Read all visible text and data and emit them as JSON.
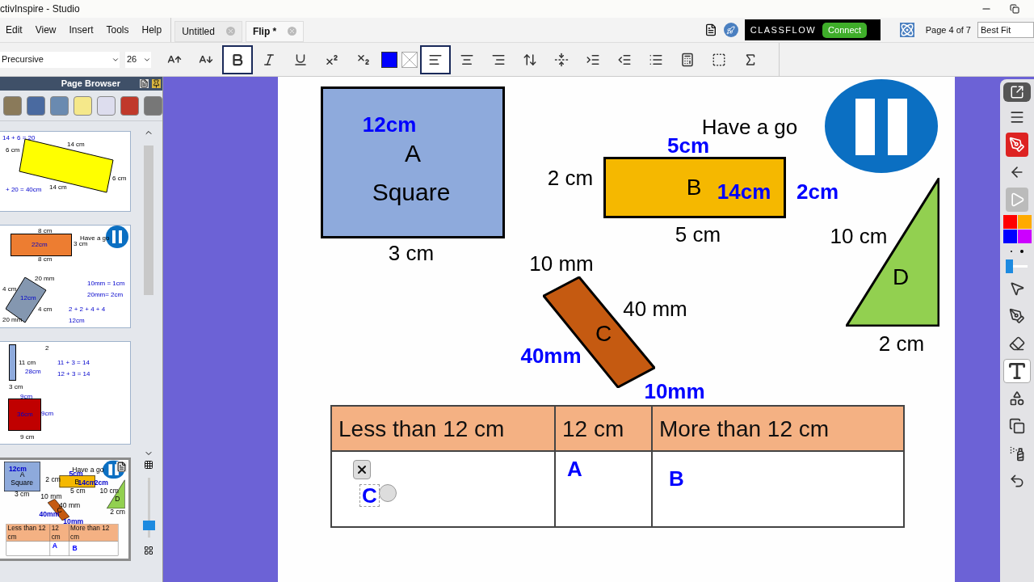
{
  "window": {
    "title": "ctivInspire - Studio"
  },
  "menu": [
    "Edit",
    "View",
    "Insert",
    "Tools",
    "Help"
  ],
  "tabs": [
    {
      "label": "Untitled",
      "selected": false
    },
    {
      "label": "Flip *",
      "selected": true
    }
  ],
  "classflow": {
    "brand": "CLASSFLOW",
    "button": "Connect"
  },
  "page_indicator": "Page 4 of 7",
  "zoom": {
    "value": "Best Fit"
  },
  "format_toolbar": {
    "font": "Precursive",
    "size": "26",
    "tools": [
      {
        "kind": "grow",
        "selected": false
      },
      {
        "kind": "shrink",
        "selected": false
      },
      {
        "kind": "bold",
        "selected": true
      },
      {
        "kind": "italic",
        "selected": false
      },
      {
        "kind": "underline",
        "selected": false
      },
      {
        "kind": "superscript",
        "selected": false
      },
      {
        "kind": "subscript",
        "selected": false
      },
      {
        "kind": "swatch",
        "selected": false
      },
      {
        "kind": "nofill",
        "selected": false
      },
      {
        "kind": "align-left",
        "selected": true
      },
      {
        "kind": "align-center",
        "selected": false
      },
      {
        "kind": "align-right",
        "selected": false
      },
      {
        "kind": "spacing",
        "selected": false
      },
      {
        "kind": "condense",
        "selected": false
      },
      {
        "kind": "indent",
        "selected": false
      },
      {
        "kind": "outdent",
        "selected": false
      },
      {
        "kind": "bullets",
        "selected": false
      },
      {
        "kind": "keypad",
        "selected": false
      },
      {
        "kind": "select",
        "selected": false
      },
      {
        "kind": "sigma",
        "selected": false
      }
    ]
  },
  "page_browser": {
    "title": "Page Browser",
    "size_slider": {
      "level": 0.2
    },
    "thumbnails": [
      {
        "selected": false,
        "texts": [
          {
            "text": "14 + 6 = 20",
            "kind": "answer"
          },
          {
            "text": "6 cm",
            "kind": "measure"
          },
          {
            "text": "14 cm",
            "kind": "measure"
          },
          {
            "text": "6 cm",
            "kind": "measure"
          },
          {
            "text": "+ 20 = 40cm",
            "kind": "answer"
          },
          {
            "text": "14 cm",
            "kind": "measure"
          }
        ]
      },
      {
        "selected": false,
        "texts": [
          {
            "text": "8 cm",
            "kind": "measure"
          },
          {
            "text": "22cm",
            "kind": "answer"
          },
          {
            "text": "3 cm",
            "kind": "measure"
          },
          {
            "text": "8 cm",
            "kind": "measure"
          },
          {
            "text": "Have a go",
            "kind": "measure"
          },
          {
            "text": "20 mm",
            "kind": "measure"
          },
          {
            "text": "4 cm",
            "kind": "measure"
          },
          {
            "text": "12cm",
            "kind": "answer"
          },
          {
            "text": "4 cm",
            "kind": "measure"
          },
          {
            "text": "20 mm",
            "kind": "measure"
          },
          {
            "text": "10mm = 1cm",
            "kind": "answer"
          },
          {
            "text": "20mm= 2cm",
            "kind": "answer"
          },
          {
            "text": "2 + 2 + 4 + 4",
            "kind": "answer"
          },
          {
            "text": "12cm",
            "kind": "answer"
          }
        ]
      },
      {
        "selected": false,
        "texts": [
          {
            "text": "2",
            "kind": "measure"
          },
          {
            "text": "11 cm",
            "kind": "measure"
          },
          {
            "text": "28cm",
            "kind": "answer"
          },
          {
            "text": "3 cm",
            "kind": "measure"
          },
          {
            "text": "11 + 3 = 14",
            "kind": "answer"
          },
          {
            "text": "12 + 3 = 14",
            "kind": "answer"
          },
          {
            "text": "9cm",
            "kind": "answer"
          },
          {
            "text": "36cm",
            "kind": "answer"
          },
          {
            "text": "9cm",
            "kind": "answer"
          },
          {
            "text": "9 cm",
            "kind": "measure"
          }
        ]
      },
      {
        "selected": true,
        "page": {
          "shapes": [
            {
              "kind": "rect",
              "color": "#8eaadc"
            },
            {
              "kind": "rect",
              "color": "#f5b800"
            },
            {
              "kind": "slanted",
              "color": "#c55a11"
            },
            {
              "kind": "triangle",
              "color": "#92d050"
            }
          ],
          "labels": [
            {
              "text": "12cm",
              "kind": "answer"
            },
            {
              "text": "A",
              "kind": "measure"
            },
            {
              "text": "Square",
              "kind": "measure"
            },
            {
              "text": "3 cm",
              "kind": "measure"
            },
            {
              "text": "Have a go",
              "kind": "measure"
            },
            {
              "text": "5cm",
              "kind": "answer"
            },
            {
              "text": "2 cm",
              "kind": "measure"
            },
            {
              "text": "B",
              "kind": "measure"
            },
            {
              "text": "14cm",
              "kind": "answer"
            },
            {
              "text": "2cm",
              "kind": "answer"
            },
            {
              "text": "5 cm",
              "kind": "measure"
            },
            {
              "text": "10 cm",
              "kind": "measure"
            },
            {
              "text": "D",
              "kind": "measure"
            },
            {
              "text": "2 cm",
              "kind": "measure"
            },
            {
              "text": "10 mm",
              "kind": "measure"
            },
            {
              "text": "40 mm",
              "kind": "measure"
            },
            {
              "text": "C",
              "kind": "measure"
            },
            {
              "text": "40mm",
              "kind": "answer"
            },
            {
              "text": "10mm",
              "kind": "answer"
            }
          ],
          "table": {
            "columns": [
              "Less than 12 cm",
              "12 cm",
              "More than 12 cm"
            ],
            "cells": [
              null,
              {
                "text": "A",
                "editing": false
              },
              {
                "text": "B",
                "editing": false
              }
            ]
          }
        }
      }
    ]
  },
  "page": {
    "shapes": [
      {
        "kind": "rect",
        "color": "#8eaadc"
      },
      {
        "kind": "rect",
        "color": "#f5b800"
      },
      {
        "kind": "slanted",
        "color": "#c55a11"
      },
      {
        "kind": "triangle",
        "color": "#92d050"
      }
    ],
    "labels": [
      {
        "text": "12cm",
        "color": "#0000ff"
      },
      {
        "text": "A",
        "color": "#000000"
      },
      {
        "text": "Square",
        "color": "#000000"
      },
      {
        "text": "3 cm",
        "color": "#000000"
      },
      {
        "text": "Have a go",
        "color": "#000000"
      },
      {
        "text": "5cm",
        "color": "#0000ff"
      },
      {
        "text": "2 cm",
        "color": "#000000"
      },
      {
        "text": "B",
        "color": "#000000"
      },
      {
        "text": "14cm",
        "color": "#0000ff"
      },
      {
        "text": "2cm",
        "color": "#0000ff"
      },
      {
        "text": "5 cm",
        "color": "#000000"
      },
      {
        "text": "10 cm",
        "color": "#000000"
      },
      {
        "text": "D",
        "color": "#000000"
      },
      {
        "text": "2 cm",
        "color": "#000000"
      },
      {
        "text": "10 mm",
        "color": "#000000"
      },
      {
        "text": "40 mm",
        "color": "#000000"
      },
      {
        "text": "C",
        "color": "#000000"
      },
      {
        "text": "40mm",
        "color": "#0000ff"
      },
      {
        "text": "10mm",
        "color": "#0000ff"
      }
    ],
    "table": {
      "columns": [
        "Less than 12 cm",
        "12 cm",
        "More than 12 cm"
      ],
      "cells": [
        {
          "text": "C",
          "editing": true
        },
        {
          "text": "A",
          "editing": false
        },
        {
          "text": "B",
          "editing": false
        }
      ]
    }
  },
  "toolbox": {
    "tools": [
      {
        "kind": "menu",
        "selected": false
      },
      {
        "kind": "record",
        "selected": false
      },
      {
        "kind": "back",
        "selected": false
      },
      {
        "kind": "play",
        "selected": false
      },
      {
        "kind": "pointer",
        "selected": false
      },
      {
        "kind": "pen",
        "selected": false
      },
      {
        "kind": "eraser",
        "selected": false
      },
      {
        "kind": "text",
        "selected": true
      },
      {
        "kind": "shapes",
        "selected": false
      },
      {
        "kind": "pages",
        "selected": false
      },
      {
        "kind": "spray",
        "selected": false
      },
      {
        "kind": "undo",
        "selected": false
      }
    ],
    "colors": [
      {
        "color": "#ff0000"
      },
      {
        "color": "#ffaa00"
      },
      {
        "color": "#0000ff"
      },
      {
        "color": "#cc00ff"
      }
    ],
    "pen_size": {
      "level": 0.1
    }
  }
}
